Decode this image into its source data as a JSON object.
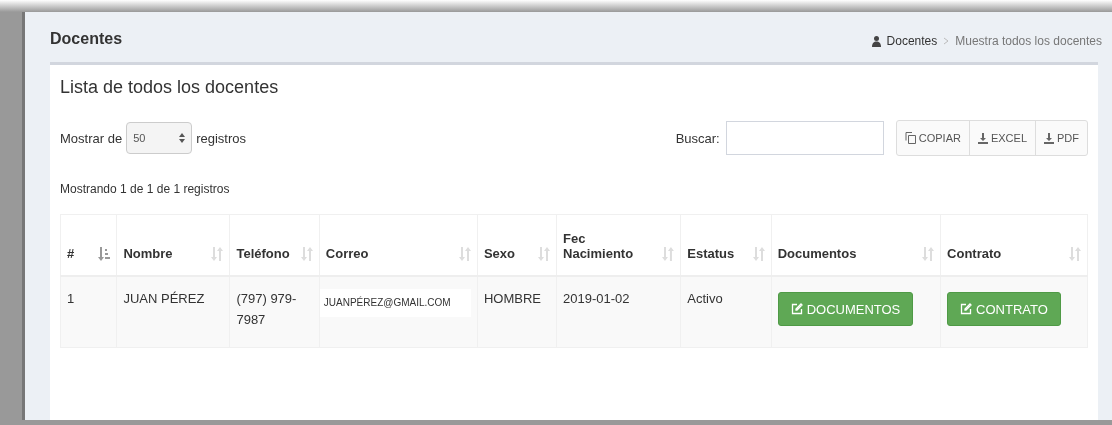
{
  "page": {
    "title": "Docentes"
  },
  "breadcrumb": [
    {
      "label": "Docentes"
    },
    {
      "label": "Muestra todos los docentes"
    }
  ],
  "box": {
    "title": "Lista de todos los docentes"
  },
  "length_control": {
    "before": "Mostrar de",
    "value": "50",
    "after": "registros"
  },
  "search": {
    "label": "Buscar:"
  },
  "export_buttons": [
    {
      "kind": "copy",
      "label": "COPIAR"
    },
    {
      "kind": "download",
      "label": "EXCEL"
    },
    {
      "kind": "download",
      "label": "PDF"
    }
  ],
  "info": "Mostrando 1 de 1 de 1 registros",
  "table": {
    "columns": [
      {
        "label": "#",
        "sorted": true
      },
      {
        "label": "Nombre",
        "sorted": false
      },
      {
        "label": "Teléfono",
        "sorted": false
      },
      {
        "label": "Correo",
        "sorted": false
      },
      {
        "label": "Sexo",
        "sorted": false
      },
      {
        "label": "Fec Nacimiento",
        "sorted": false
      },
      {
        "label": "Estatus",
        "sorted": false
      },
      {
        "label": "Documentos",
        "sorted": false
      },
      {
        "label": "Contrato",
        "sorted": false
      }
    ],
    "rows": [
      {
        "cells": [
          {
            "kind": "text",
            "text": "1"
          },
          {
            "kind": "text",
            "text": "JUAN PÉREZ"
          },
          {
            "kind": "text",
            "text": "(797) 979-7987"
          },
          {
            "kind": "email",
            "text": "JUANPÉREZ@GMAIL.COM"
          },
          {
            "kind": "text",
            "text": "HOMBRE"
          },
          {
            "kind": "text",
            "text": "2019-01-02"
          },
          {
            "kind": "text",
            "text": "Activo"
          },
          {
            "kind": "button",
            "text": "DOCUMENTOS"
          },
          {
            "kind": "button",
            "text": "CONTRATO"
          }
        ]
      }
    ]
  }
}
